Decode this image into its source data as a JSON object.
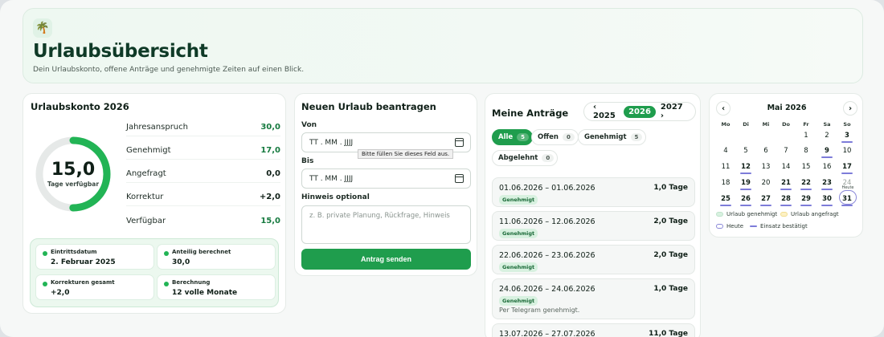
{
  "hero": {
    "icon": "palm-tree-icon",
    "title": "Urlaubsübersicht",
    "subtitle": "Dein Urlaubskonto, offene Anträge und genehmigte Zeiten auf einen Blick."
  },
  "account": {
    "title": "Urlaubskonto 2026",
    "remaining_value": "15,0",
    "remaining_label": "Tage verfügbar",
    "ring_fraction": 0.5,
    "stats": [
      {
        "label": "Jahresanspruch",
        "value": "30,0"
      },
      {
        "label": "Genehmigt",
        "value": "17,0"
      },
      {
        "label": "Angefragt",
        "value": "0,0"
      },
      {
        "label": "Korrektur",
        "value": "+2,0"
      },
      {
        "label": "Verfügbar",
        "value": "15,0"
      }
    ],
    "info": [
      {
        "key": "Eintrittsdatum",
        "value": "2. Februar 2025"
      },
      {
        "key": "Anteilig berechnet",
        "value": "30,0"
      },
      {
        "key": "Korrekturen gesamt",
        "value": "+2,0"
      },
      {
        "key": "Berechnung",
        "value": "12 volle Monate"
      }
    ]
  },
  "form": {
    "title": "Neuen Urlaub beantragen",
    "from_label": "Von",
    "from_value": "TT . MM . JJJJ",
    "to_label": "Bis",
    "to_value": "TT . MM . JJJJ",
    "tooltip": "Bitte füllen Sie dieses Feld aus.",
    "note_label": "Hinweis optional",
    "note_placeholder": "z. B. private Planung, Rückfrage, Hinweis",
    "submit_label": "Antrag senden"
  },
  "requests": {
    "title": "Meine Anträge",
    "years": {
      "prev": "‹ 2025",
      "current": "2026",
      "next": "2027 ›"
    },
    "filters": [
      {
        "label": "Alle",
        "count": "5"
      },
      {
        "label": "Offen",
        "count": "0"
      },
      {
        "label": "Genehmigt",
        "count": "5"
      },
      {
        "label": "Abgelehnt",
        "count": "0"
      }
    ],
    "items": [
      {
        "dates": "01.06.2026 – 01.06.2026",
        "days": "1,0 Tage",
        "status": "Genehmigt",
        "note": ""
      },
      {
        "dates": "11.06.2026 – 12.06.2026",
        "days": "2,0 Tage",
        "status": "Genehmigt",
        "note": ""
      },
      {
        "dates": "22.06.2026 – 23.06.2026",
        "days": "2,0 Tage",
        "status": "Genehmigt",
        "note": ""
      },
      {
        "dates": "24.06.2026 – 24.06.2026",
        "days": "1,0 Tage",
        "status": "Genehmigt",
        "note": "Per Telegram genehmigt."
      },
      {
        "dates": "13.07.2026 – 27.07.2026",
        "days": "11,0 Tage",
        "status": "",
        "note": ""
      }
    ]
  },
  "calendar": {
    "title": "Mai 2026",
    "prev_icon": "chevron-left-icon",
    "next_icon": "chevron-right-icon",
    "weekdays": [
      "Mo",
      "Di",
      "Mi",
      "Do",
      "Fr",
      "Sa",
      "So"
    ],
    "weeks": [
      [
        "",
        "",
        "",
        "",
        "1",
        "2",
        "3"
      ],
      [
        "4",
        "5",
        "6",
        "7",
        "8",
        "9",
        "10"
      ],
      [
        "11",
        "12",
        "13",
        "14",
        "15",
        "16",
        "17"
      ],
      [
        "18",
        "19",
        "20",
        "21",
        "22",
        "23",
        "24"
      ],
      [
        "25",
        "26",
        "27",
        "28",
        "29",
        "30",
        "31"
      ]
    ],
    "today_label": "Heute",
    "legend": [
      {
        "label": "Urlaub genehmigt",
        "color": "#d8f1e0"
      },
      {
        "label": "Urlaub angefragt",
        "color": "#fdf1c4"
      },
      {
        "label": "Heute",
        "color": "#8a88d8"
      },
      {
        "label": "Einsatz bestätigt",
        "color": "#7d7cd9"
      }
    ]
  },
  "colors": {
    "accent": "#1f9d4d",
    "ring_track": "#e6e9e8",
    "marker": "#7d7cd9"
  }
}
